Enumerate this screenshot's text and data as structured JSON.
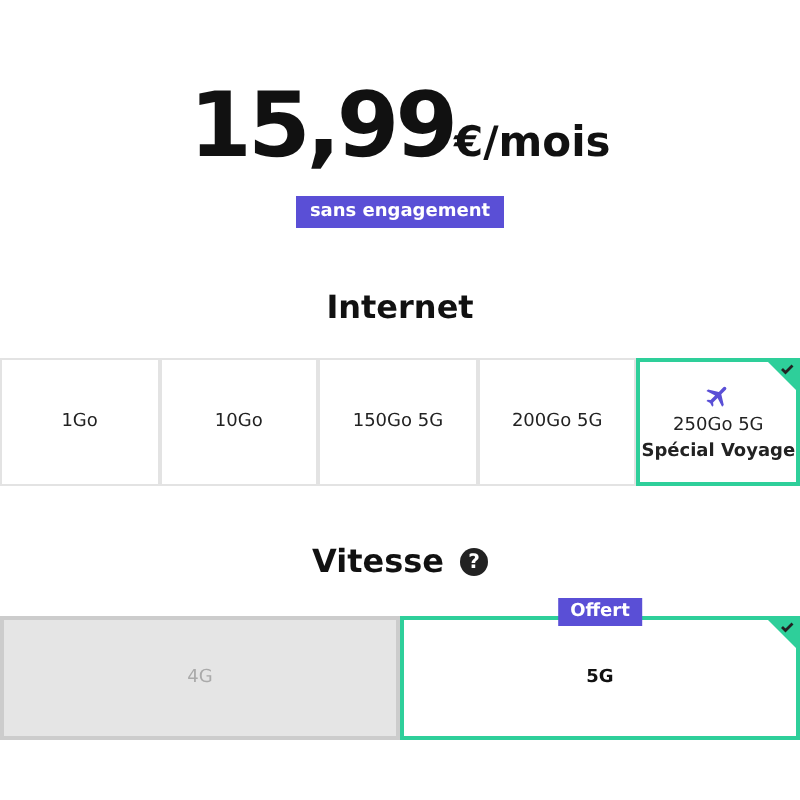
{
  "price": {
    "amount": "15,99",
    "unit": "€/mois"
  },
  "badge": "sans engagement",
  "internet": {
    "title": "Internet",
    "options": [
      {
        "kind": "plain",
        "label": "1Go",
        "selected": false
      },
      {
        "kind": "plain",
        "label": "10Go",
        "selected": false
      },
      {
        "kind": "plain",
        "label": "150Go 5G",
        "selected": false
      },
      {
        "kind": "plain",
        "label": "200Go 5G",
        "selected": false
      },
      {
        "kind": "travel",
        "label": "250Go 5G",
        "sublabel": "Spécial Voyage",
        "selected": true
      }
    ]
  },
  "speed": {
    "title": "Vitesse",
    "help": "?",
    "options": [
      {
        "label": "4G",
        "selected": false,
        "disabled": true
      },
      {
        "label": "5G",
        "selected": true,
        "disabled": false,
        "tag": "Offert"
      }
    ]
  }
}
